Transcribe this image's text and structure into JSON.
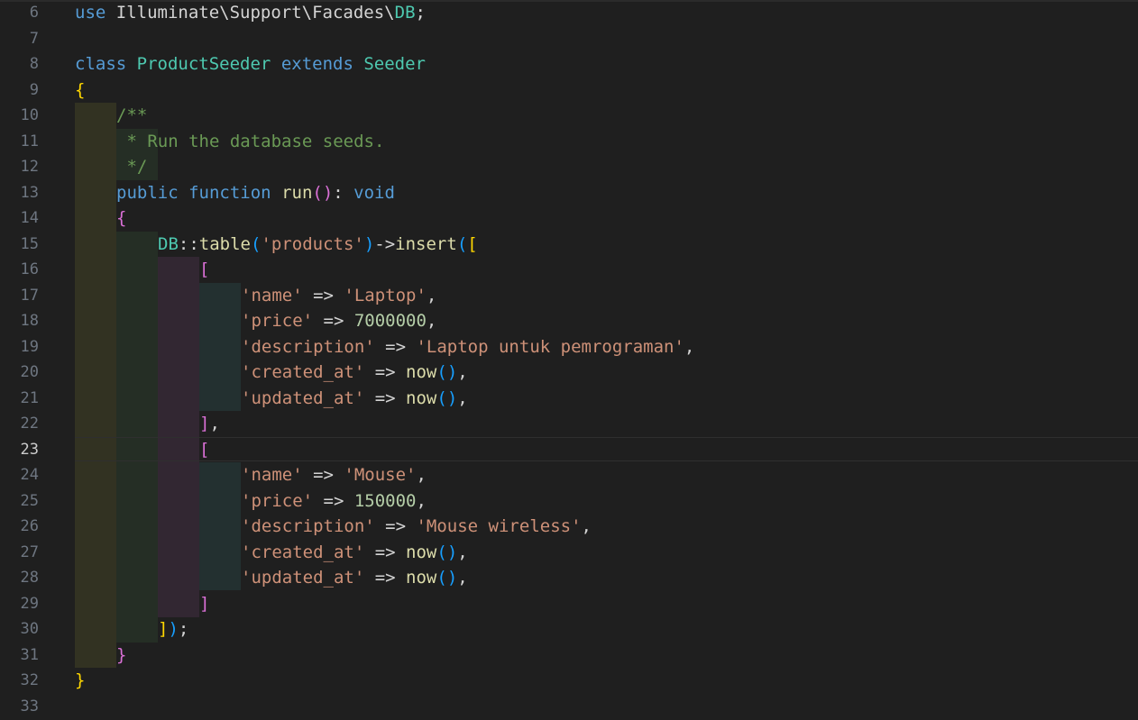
{
  "editor": {
    "active_line": "23",
    "line_numbers": [
      "6",
      "7",
      "8",
      "9",
      "10",
      "11",
      "12",
      "13",
      "14",
      "15",
      "16",
      "17",
      "18",
      "19",
      "20",
      "21",
      "22",
      "23",
      "24",
      "25",
      "26",
      "27",
      "28",
      "29",
      "30",
      "31",
      "32",
      "33"
    ],
    "code": {
      "l6_kw": "use",
      "l6_ns": " Illuminate\\Support\\Facades\\",
      "l6_cls": "DB",
      "l6_end": ";",
      "l8_kw": "class",
      "l8_name": "ProductSeeder",
      "l8_extends": "extends",
      "l8_parent": "Seeder",
      "l9_brace": "{",
      "l10_com": "/**",
      "l11_com": " * Run the database seeds.",
      "l12_com": " */",
      "l13_public": "public",
      "l13_function": "function",
      "l13_name": "run",
      "l13_parens": "()",
      "l13_colon": ": ",
      "l13_type": "void",
      "l14_brace": "{",
      "l15_cls": "DB",
      "l15_sep": "::",
      "l15_fn": "table",
      "l15_p1": "(",
      "l15_str": "'products'",
      "l15_p2": ")",
      "l15_arrow": "->",
      "l15_fn2": "insert",
      "l15_p3": "(",
      "l15_br": "[",
      "l16_br": "[",
      "l17_key": "'name'",
      "l17_op": " => ",
      "l17_val": "'Laptop'",
      "l17_end": ",",
      "l18_key": "'price'",
      "l18_op": " => ",
      "l18_val": "7000000",
      "l18_end": ",",
      "l19_key": "'description'",
      "l19_op": " => ",
      "l19_val": "'Laptop untuk pemrograman'",
      "l19_end": ",",
      "l20_key": "'created_at'",
      "l20_op": " => ",
      "l20_fn": "now",
      "l20_parens": "()",
      "l20_end": ",",
      "l21_key": "'updated_at'",
      "l21_op": " => ",
      "l21_fn": "now",
      "l21_parens": "()",
      "l21_end": ",",
      "l22_br": "]",
      "l22_end": ",",
      "l23_br": "[",
      "l24_key": "'name'",
      "l24_op": " => ",
      "l24_val": "'Mouse'",
      "l24_end": ",",
      "l25_key": "'price'",
      "l25_op": " => ",
      "l25_val": "150000",
      "l25_end": ",",
      "l26_key": "'description'",
      "l26_op": " => ",
      "l26_val": "'Mouse wireless'",
      "l26_end": ",",
      "l27_key": "'created_at'",
      "l27_op": " => ",
      "l27_fn": "now",
      "l27_parens": "()",
      "l27_end": ",",
      "l28_key": "'updated_at'",
      "l28_op": " => ",
      "l28_fn": "now",
      "l28_parens": "()",
      "l28_end": ",",
      "l29_br": "]",
      "l30_br": "]",
      "l30_paren": ")",
      "l30_end": ";",
      "l31_brace": "}",
      "l32_brace": "}"
    }
  },
  "colors": {
    "background": "#1f1f1f",
    "keyword": "#569cd6",
    "control_keyword": "#c586c0",
    "class": "#4ec9b0",
    "function": "#dcdcaa",
    "string": "#ce9178",
    "number": "#b5cea8",
    "comment": "#6a9955",
    "bracket_level1": "#ffd700",
    "bracket_level2": "#da70d6",
    "bracket_level3": "#179fff"
  }
}
